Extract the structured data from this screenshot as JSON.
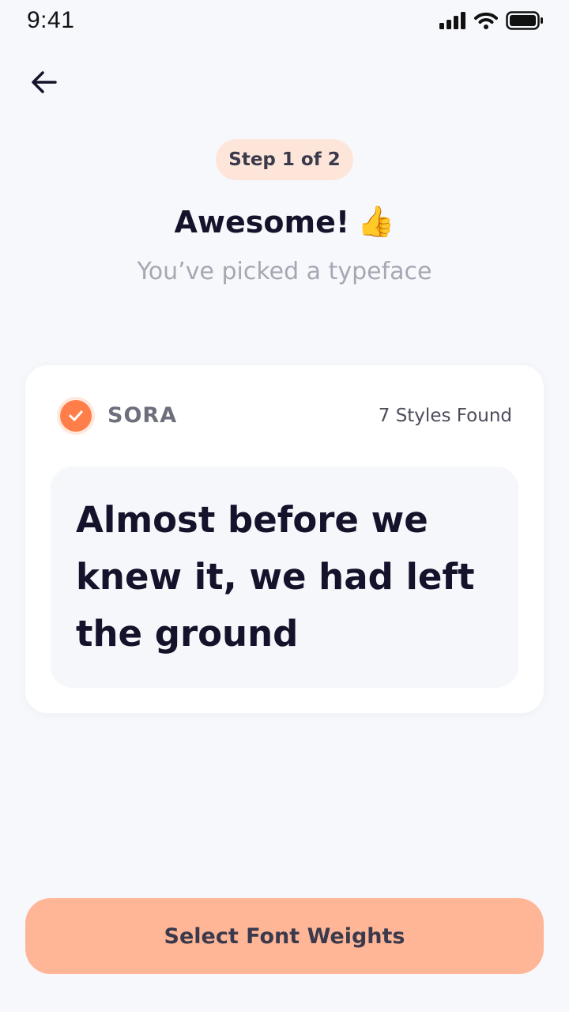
{
  "status_bar": {
    "time": "9:41"
  },
  "header": {
    "step": "Step 1 of 2"
  },
  "headline": {
    "title": "Awesome!",
    "emoji": "👍"
  },
  "subtitle": "You’ve picked a typeface",
  "font_card": {
    "font_name": "SORA",
    "styles_found": "7 Styles Found",
    "sample_text": "Almost before we knew it, we had left the ground",
    "selected": true
  },
  "actions": {
    "primary_label": "Select Font Weights"
  },
  "colors": {
    "accent": "#ff7e49",
    "button": "#ffb697",
    "badge": "#fde5da",
    "background": "#f7f8fc"
  },
  "icons": [
    "signal-icon",
    "wifi-icon",
    "battery-icon",
    "back-arrow-icon",
    "check-icon"
  ]
}
